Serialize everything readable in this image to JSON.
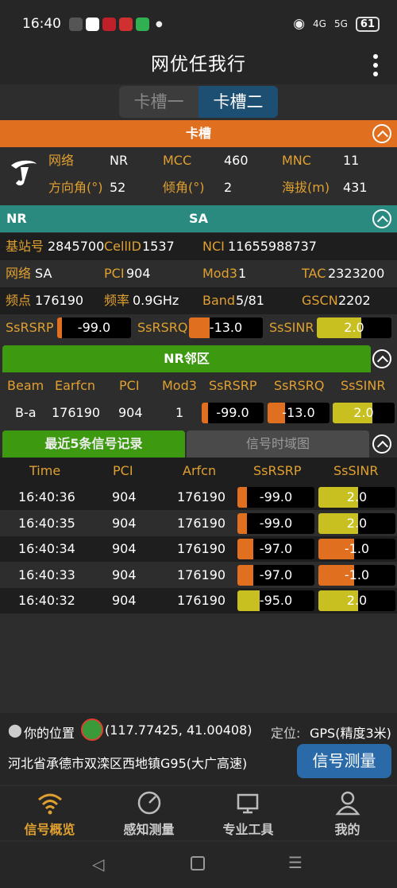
{
  "status": {
    "time": "16:40",
    "sig1": "4G",
    "sig2": "5G",
    "battery": "61"
  },
  "app": {
    "title": "网优任我行"
  },
  "tabs": {
    "slot1": "卡槽一",
    "slot2": "卡槽二"
  },
  "sim": {
    "header": "卡槽",
    "network_label": "网络",
    "network": "NR",
    "mcc_label": "MCC",
    "mcc": "460",
    "mnc_label": "MNC",
    "mnc": "11",
    "azimuth_label": "方向角(°)",
    "azimuth": "52",
    "tilt_label": "倾角(°)",
    "tilt": "2",
    "altitude_label": "海拔(m)",
    "altitude": "431"
  },
  "nr": {
    "header_left": "NR",
    "header_center": "SA",
    "gnb_label": "基站号",
    "gnb": "2845700",
    "cellid_label": "CellID",
    "cellid": "1537",
    "nci_label": "NCI",
    "nci": "11655988737",
    "net_label": "网络",
    "net": "SA",
    "pci_label": "PCI",
    "pci": "904",
    "mod3_label": "Mod3",
    "mod3": "1",
    "tac_label": "TAC",
    "tac": "2323200",
    "arfcn_label": "频点",
    "arfcn": "176190",
    "freq_label": "频率",
    "freq": "0.9GHz",
    "band_label": "Band",
    "band": "5/81",
    "gscn_label": "GSCN",
    "gscn": "2202",
    "rsrp_label": "SsRSRP",
    "rsrp": "-99.0",
    "rsrp_level": 0.05,
    "rsrq_label": "SsRSRQ",
    "rsrq": "-13.0",
    "rsrq_level": 0.28,
    "sinr_label": "SsSINR",
    "sinr": "2.0",
    "sinr_level": 0.6
  },
  "neighbor": {
    "header": "NR邻区",
    "cols": [
      "Beam",
      "Earfcn",
      "PCI",
      "Mod3",
      "SsRSRP",
      "SsRSRQ",
      "SsSINR"
    ],
    "row": {
      "beam": "B-a",
      "earfcn": "176190",
      "pci": "904",
      "mod3": "1",
      "rsrp": "-99.0",
      "rsrq": "-13.0",
      "sinr": "2.0"
    }
  },
  "records": {
    "tab_active": "最近5条信号记录",
    "tab_inactive": "信号时域图",
    "cols": [
      "Time",
      "PCI",
      "Arfcn",
      "SsRSRP",
      "SsSINR"
    ],
    "rows": [
      {
        "time": "16:40:36",
        "pci": "904",
        "arfcn": "176190",
        "rsrp": "-99.0",
        "sinr": "2.0",
        "rsrp_color": "#e07020",
        "sinr_color": "#c8c020"
      },
      {
        "time": "16:40:35",
        "pci": "904",
        "arfcn": "176190",
        "rsrp": "-99.0",
        "sinr": "2.0",
        "rsrp_color": "#e07020",
        "sinr_color": "#c8c020"
      },
      {
        "time": "16:40:34",
        "pci": "904",
        "arfcn": "176190",
        "rsrp": "-97.0",
        "sinr": "-1.0",
        "rsrp_color": "#e07020",
        "sinr_color": "#e07020"
      },
      {
        "time": "16:40:33",
        "pci": "904",
        "arfcn": "176190",
        "rsrp": "-97.0",
        "sinr": "-1.0",
        "rsrp_color": "#e07020",
        "sinr_color": "#e07020"
      },
      {
        "time": "16:40:32",
        "pci": "904",
        "arfcn": "176190",
        "rsrp": "-95.0",
        "sinr": "2.0",
        "rsrp_color": "#c8c020",
        "sinr_color": "#c8c020"
      }
    ]
  },
  "location": {
    "label": "你的位置",
    "coords": "(117.77425, 41.00408)",
    "mode_label": "定位:",
    "mode": "GPS(精度3米)",
    "address": "河北省承德市双滦区西地镇G95(大广高速)",
    "measure_button": "信号测量"
  },
  "nav": {
    "items": [
      "信号概览",
      "感知测量",
      "专业工具",
      "我的"
    ]
  },
  "colors": {
    "orange": "#e07020",
    "teal": "#2a8a80",
    "green": "#3d9a10",
    "blue": "#1d4f73",
    "label": "#e0a030",
    "yellow": "#c8c020"
  }
}
